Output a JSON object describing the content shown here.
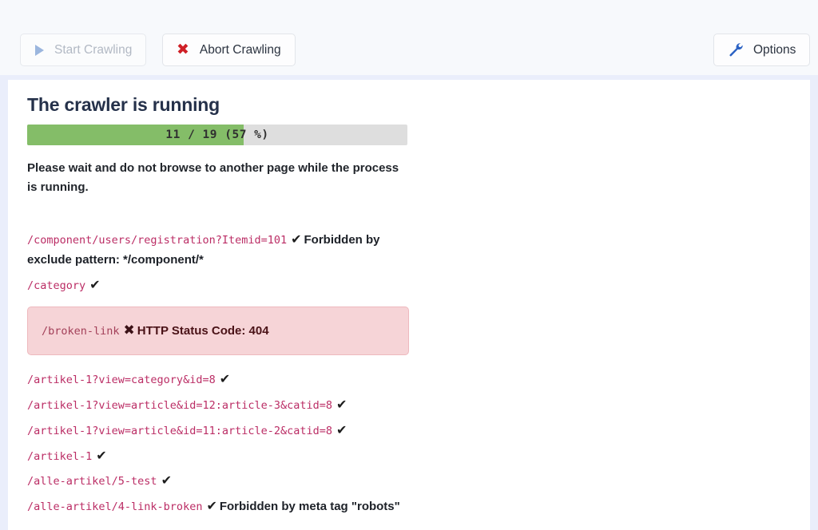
{
  "toolbar": {
    "start_button": {
      "label": "Start Crawling",
      "icon": "play-icon",
      "disabled": true
    },
    "abort_button": {
      "label": "Abort Crawling",
      "icon": "heavy-multiplication-x-icon"
    },
    "options_button": {
      "label": "Options",
      "icon": "wrench-icon"
    }
  },
  "main": {
    "title": "The crawler is running",
    "progress": {
      "label": "11 / 19 (57 %)",
      "current": 11,
      "total": 19,
      "percent": 57,
      "fill_color": "#84bd68",
      "track_color": "#dedede"
    },
    "notice": "Please wait and do not browse to another page while the process is running.",
    "log": [
      {
        "url": "/component/users/registration?Itemid=101",
        "mark": "✔",
        "message": "Forbidden by exclude pattern: */component/*",
        "status": "ok"
      },
      {
        "url": "/category",
        "mark": "✔",
        "message": "",
        "status": "ok"
      },
      {
        "url": "/broken-link",
        "mark": "✖",
        "message": "HTTP Status Code: 404",
        "status": "error"
      },
      {
        "url": "/artikel-1?view=category&id=8",
        "mark": "✔",
        "message": "",
        "status": "ok"
      },
      {
        "url": "/artikel-1?view=article&id=12:article-3&catid=8",
        "mark": "✔",
        "message": "",
        "status": "ok"
      },
      {
        "url": "/artikel-1?view=article&id=11:article-2&catid=8",
        "mark": "✔",
        "message": "",
        "status": "ok"
      },
      {
        "url": "/artikel-1",
        "mark": "✔",
        "message": "",
        "status": "ok"
      },
      {
        "url": "/alle-artikel/5-test",
        "mark": "✔",
        "message": "",
        "status": "ok"
      },
      {
        "url": "/alle-artikel/4-link-broken",
        "mark": "✔",
        "message": "Forbidden by meta tag \"robots\"",
        "status": "ok"
      }
    ]
  }
}
